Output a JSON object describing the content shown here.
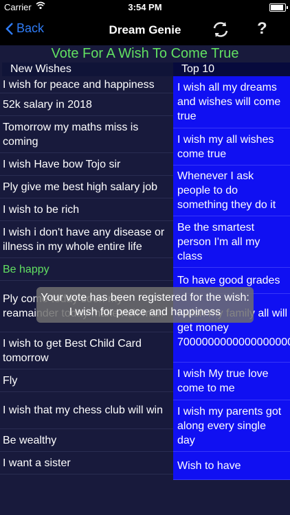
{
  "status": {
    "carrier": "Carrier",
    "time": "3:54 PM",
    "battery_level": 1.0
  },
  "nav": {
    "back_label": "Back",
    "title": "Dream Genie",
    "help_label": "?"
  },
  "subtitle": "Vote For A Wish To Come True",
  "columns": {
    "new_header": "New Wishes",
    "top_header": "Top 10"
  },
  "new_wishes": [
    "I wish for peace and happiness",
    "52k salary in 2018",
    "Tomorrow my maths miss is coming",
    "I wish Have bow Tojo sir",
    "Ply give me best high salary job",
    "I wish to be rich",
    "I wish i don't have any disease or illness in my whole entire life",
    "Be happy",
    "Ply come today soon my reamainder today make rich man",
    "I wish to get Best Child Card tomorrow",
    "Fly",
    "I wish that my chess club will win",
    "Be wealthy",
    "I want a sister"
  ],
  "top_wishes": [
    "I wish all my dreams and wishes will come true",
    "I wish my all wishes come true",
    "Whenever I ask people to do something they do it",
    "Be the smartest person I'm all my class",
    "To have good grades",
    "I wish my family all will get money 7000000000000000000",
    "I wish My true love come to me",
    "I wish my parents got along every single day",
    "Wish to have"
  ],
  "toast": "Your vote has been registered for the wish: I wish for peace and happiness",
  "colors": {
    "accent": "#2f7cf6",
    "highlight": "#62e162",
    "top_bg": "#1010f2",
    "bg": "#181a3c"
  }
}
